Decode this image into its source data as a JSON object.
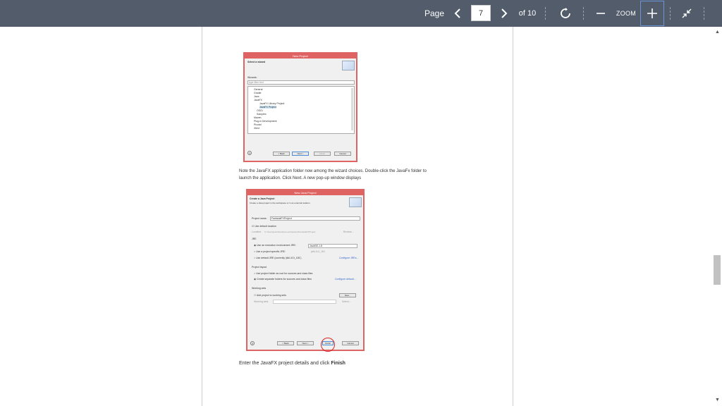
{
  "toolbar": {
    "page_label": "Page",
    "page_value": "7",
    "of_label": "of 10",
    "zoom_label": "ZOOM"
  },
  "dialog1": {
    "title": "New Project",
    "heading": "Select a wizard",
    "wizards_label": "Wizards:",
    "filter_text": "type filter text",
    "tree": [
      "General",
      "Gradle",
      "Java",
      "JavaFX",
      "JavaFX Library Project",
      "JavaFX Project",
      "OSGi",
      "Samples",
      "Maven",
      "Plug-in Development",
      "Pivotal",
      "Xtext"
    ],
    "buttons": [
      "< Back",
      "Next >",
      "Finish",
      "Cancel"
    ]
  },
  "caption1_line1": "Note the JavaFX application folder now among the wizard choices. Double-click the JavaFx folder to",
  "caption1_line2": "launch the application. Click Next. A new pop-up window displays",
  "dialog2": {
    "title": "New Java Project",
    "heading": "Create a Java Project",
    "subheading": "Create a Java project in the workspace or in an external location.",
    "project_name_label": "Project name:",
    "project_name_value": "FantasiaFXProject",
    "default_location": "Use default location",
    "location_label": "Location:",
    "location_value": "C:\\Users\\juanita\\eclipse-workspace\\FantasiaFXProject",
    "browse": "Browse...",
    "jre_label": "JRE",
    "jre_opt1": "Use an execution environment JRE:",
    "jre_opt1_value": "JavaSE-1.8",
    "jre_opt2": "Use a project specific JRE:",
    "jre_opt2_value": "jdk1.8.0_181",
    "jre_opt3": "Use default JRE (currently 'jdk1.8.0_181')",
    "configure_jres": "Configure JREs...",
    "layout_label": "Project layout",
    "layout_opt1": "Use project folder as root for sources and class files",
    "layout_opt2": "Create separate folders for sources and class files",
    "configure_default": "Configure default...",
    "working_sets_label": "Working sets",
    "add_to_working_sets": "Add project to working sets",
    "new_btn": "New...",
    "working_sets_field": "Working sets:",
    "select_btn": "Select...",
    "buttons": [
      "< Back",
      "Next >",
      "Finish",
      "Cancel"
    ]
  },
  "caption2_text": "Enter the JavaFX project details and click ",
  "caption2_bold": "Finish"
}
